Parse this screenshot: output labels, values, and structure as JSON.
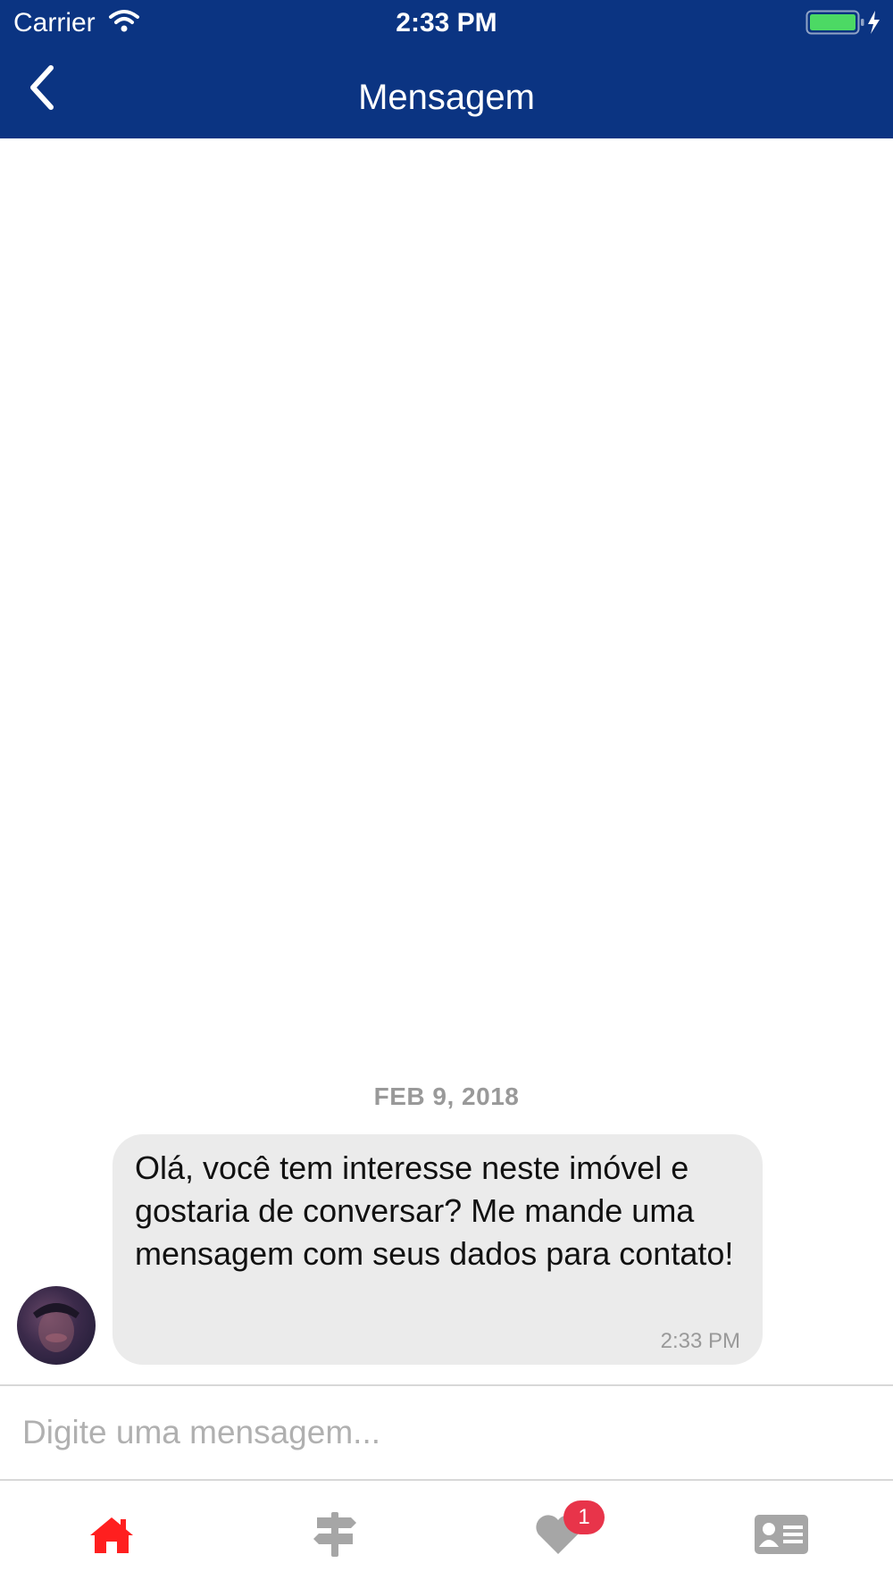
{
  "status_bar": {
    "carrier": "Carrier",
    "time": "2:33 PM"
  },
  "nav": {
    "title": "Mensagem"
  },
  "chat": {
    "date": "FEB 9, 2018",
    "message": {
      "text": "Olá, você tem interesse neste imóvel e gostaria de conversar? Me mande uma mensagem com seus dados para contato!",
      "time": "2:33 PM"
    }
  },
  "composer": {
    "placeholder": "Digite uma mensagem..."
  },
  "tabbar": {
    "items": [
      {
        "icon": "home-icon",
        "active": true
      },
      {
        "icon": "signpost-icon",
        "active": false
      },
      {
        "icon": "heart-icon",
        "active": false,
        "badge": "1"
      },
      {
        "icon": "contact-card-icon",
        "active": false
      }
    ]
  },
  "colors": {
    "header": "#0b3482",
    "active_tab": "#ff1f1f",
    "inactive_tab": "#a6a6a6",
    "badge": "#e8344a",
    "bubble": "#ebebeb"
  }
}
